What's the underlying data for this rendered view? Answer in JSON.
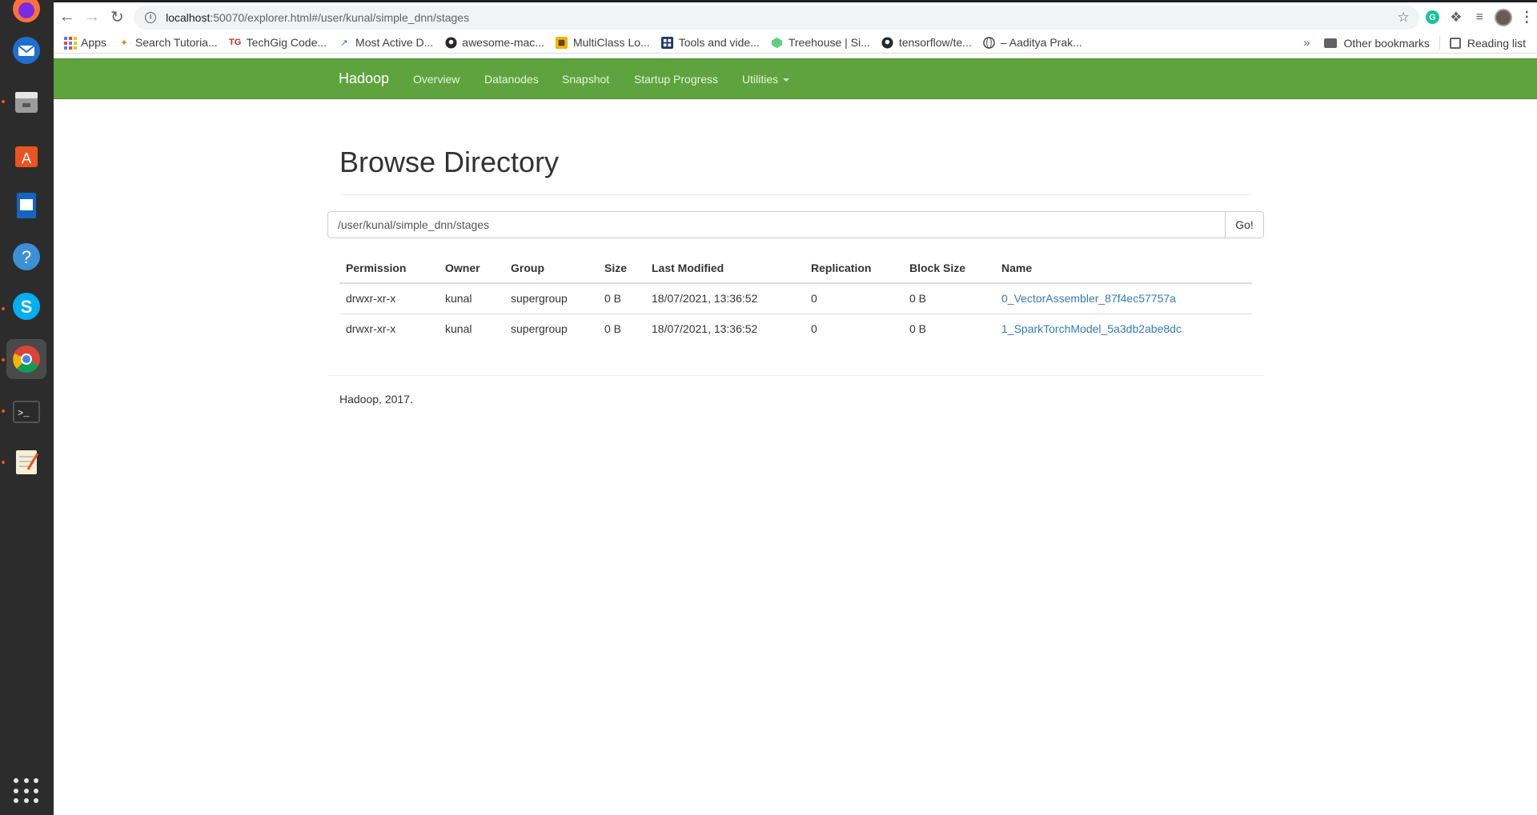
{
  "browser": {
    "url_host": "localhost",
    "url_rest": ":50070/explorer.html#/user/kunal/simple_dnn/stages",
    "bookmarks": [
      {
        "label": "Apps",
        "icon": "apps-grid-icon"
      },
      {
        "label": "Search Tutoria...",
        "icon": "tutorial-icon"
      },
      {
        "label": "TechGig Code...",
        "icon": "techgig-icon"
      },
      {
        "label": "Most Active D...",
        "icon": "chart-icon"
      },
      {
        "label": "awesome-mac...",
        "icon": "github-icon"
      },
      {
        "label": "MultiClass Lo...",
        "icon": "multiclass-icon"
      },
      {
        "label": "Tools and vide...",
        "icon": "tools-icon"
      },
      {
        "label": "Treehouse | Si...",
        "icon": "treehouse-icon"
      },
      {
        "label": "tensorflow/te...",
        "icon": "github-icon"
      },
      {
        "label": "– Aaditya Prak...",
        "icon": "globe-icon"
      }
    ],
    "other_bookmarks": "Other bookmarks",
    "reading_list": "Reading list"
  },
  "navbar": {
    "brand": "Hadoop",
    "links": [
      "Overview",
      "Datanodes",
      "Snapshot",
      "Startup Progress",
      "Utilities"
    ]
  },
  "page": {
    "title": "Browse Directory",
    "path_value": "/user/kunal/simple_dnn/stages",
    "go_label": "Go!",
    "footer": "Hadoop, 2017."
  },
  "table": {
    "headers": [
      "Permission",
      "Owner",
      "Group",
      "Size",
      "Last Modified",
      "Replication",
      "Block Size",
      "Name"
    ],
    "rows": [
      [
        "drwxr-xr-x",
        "kunal",
        "supergroup",
        "0 B",
        "18/07/2021, 13:36:52",
        "0",
        "0 B",
        "0_VectorAssembler_87f4ec57757a"
      ],
      [
        "drwxr-xr-x",
        "kunal",
        "supergroup",
        "0 B",
        "18/07/2021, 13:36:52",
        "0",
        "0 B",
        "1_SparkTorchModel_5a3db2abe8dc"
      ]
    ]
  },
  "colors": {
    "navbar_green": "#5fa33e",
    "link_blue": "#337ab7",
    "dock_bg": "#2c2c2c"
  }
}
